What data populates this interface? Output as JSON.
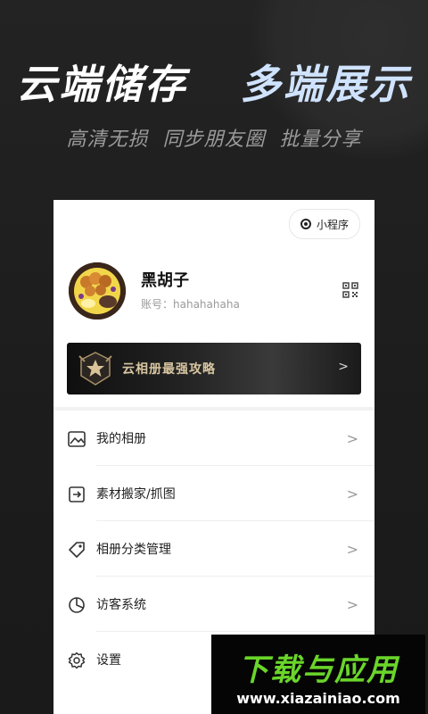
{
  "promo": {
    "headline_left": "云端储存",
    "headline_right": "多端展示",
    "subline": "高清无损  同步朋友圈  批量分享"
  },
  "profile": {
    "mini_program_label": "小程序",
    "name": "黑胡子",
    "account": "账号：hahahahaha"
  },
  "banner": {
    "text": "云相册最强攻略",
    "chevron": ">"
  },
  "menu": {
    "items": [
      {
        "label": "我的相册",
        "icon": "album-icon"
      },
      {
        "label": "素材搬家/抓图",
        "icon": "import-icon"
      },
      {
        "label": "相册分类管理",
        "icon": "tag-icon"
      },
      {
        "label": "访客系统",
        "icon": "pie-chart-icon"
      },
      {
        "label": "设置",
        "icon": "gear-icon"
      }
    ],
    "chevron": ">"
  },
  "watermark": {
    "title": "下载与应用",
    "url": "www.xiazainiao.com"
  },
  "colors": {
    "background": "#1f1f1f",
    "headline_accent": "#cfe3ff",
    "watermark_green": "#6ad52a",
    "banner_text": "#d8c6a1"
  }
}
